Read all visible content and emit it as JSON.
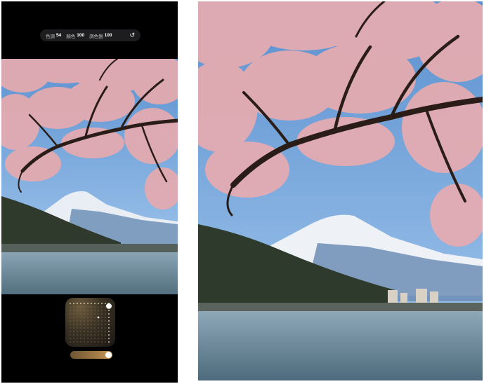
{
  "toolbar": {
    "tone_label": "色調",
    "tone_value": "54",
    "warmth_label": "顏色",
    "warmth_value": "100",
    "palette_label": "調色盤",
    "palette_value": "100",
    "reset_icon": "reset-icon"
  },
  "controls": {
    "tone_pad_level": {
      "tone": 54,
      "color": 100
    },
    "palette_slider_level": 100
  },
  "colors": {
    "sky": "#7fb2e0",
    "blossom": "#e8b8b6",
    "branch": "#2a1d17",
    "lake": "#7a97a8",
    "accent_gold": "#c99b5c"
  }
}
